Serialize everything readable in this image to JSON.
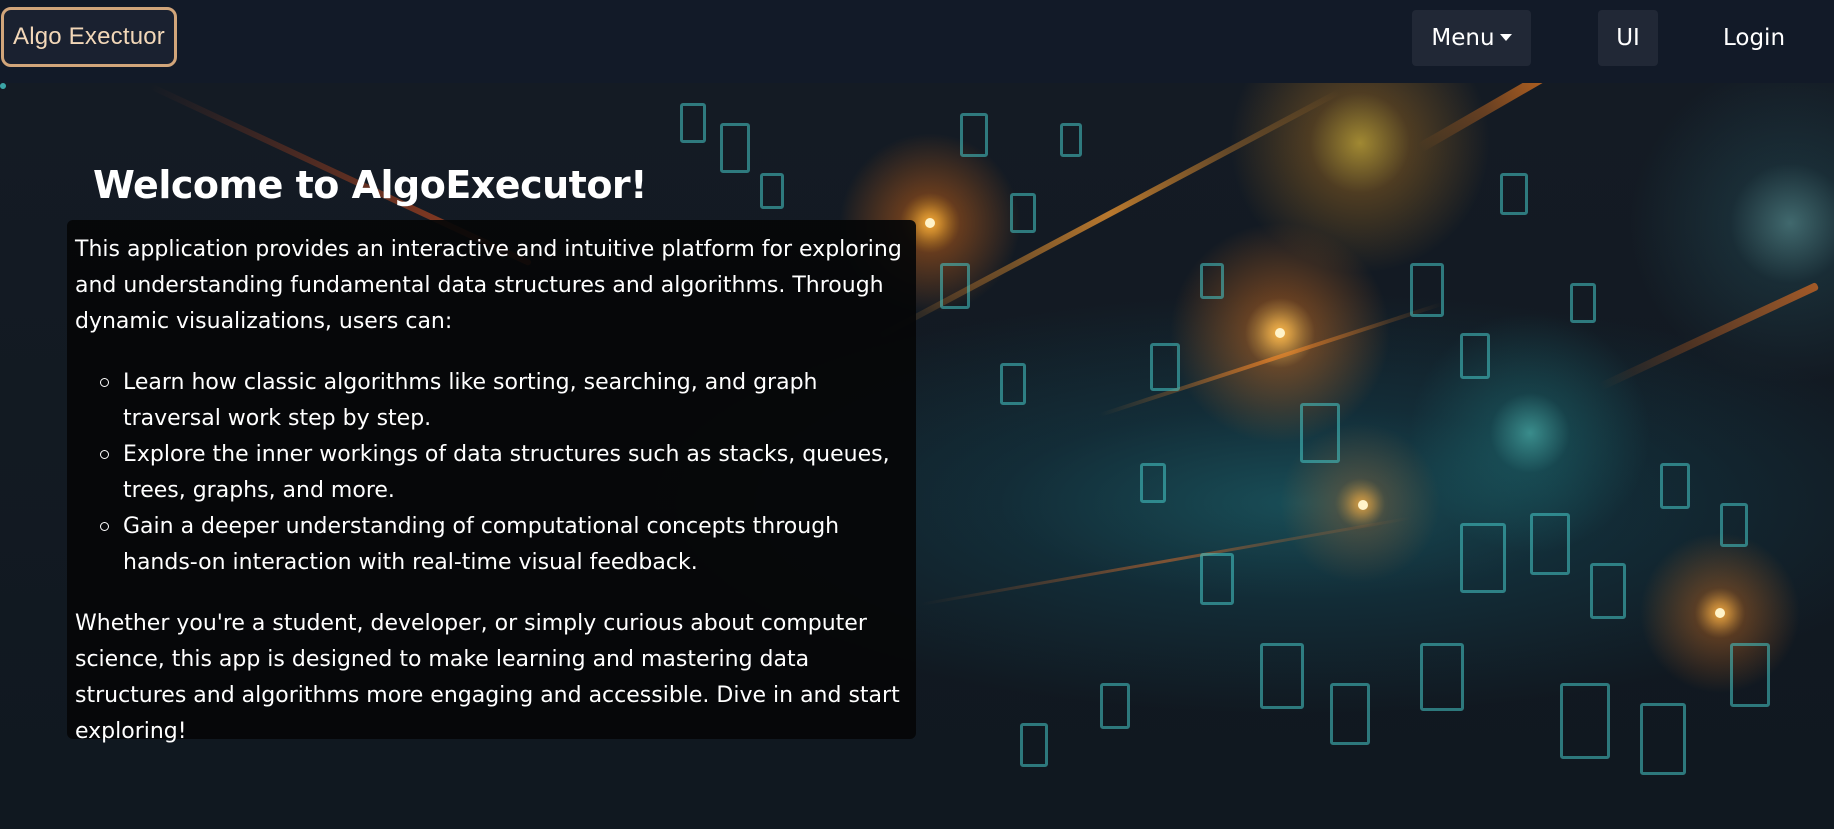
{
  "navbar": {
    "brand": "Algo Exectuor",
    "menu_label": "Menu",
    "ui_label": "UI",
    "login_label": "Login"
  },
  "main": {
    "title": "Welcome to AlgoExecutor!",
    "intro": "This application provides an interactive and intuitive platform for exploring and understanding fundamental data structures and algorithms. Through dynamic visualizations, users can:",
    "features": [
      "Learn how classic algorithms like sorting, searching, and graph traversal work step by step.",
      "Explore the inner workings of data structures such as stacks, queues, trees, graphs, and more.",
      "Gain a deeper understanding of computational concepts through hands-on interaction with real-time visual feedback."
    ],
    "outro": "Whether you're a student, developer, or simply curious about computer science, this app is designed to make learning and mastering data structures and algorithms more engaging and accessible. Dive in and start exploring!"
  },
  "colors": {
    "navbar_bg": "#121a28",
    "brand_border": "#d1a57a",
    "brand_text": "#f2d7b8",
    "button_bg": "#212836",
    "card_bg": "#050608"
  },
  "icons": {
    "menu_caret": "caret-down-icon",
    "list_bullet": "circle-bullet-icon"
  }
}
